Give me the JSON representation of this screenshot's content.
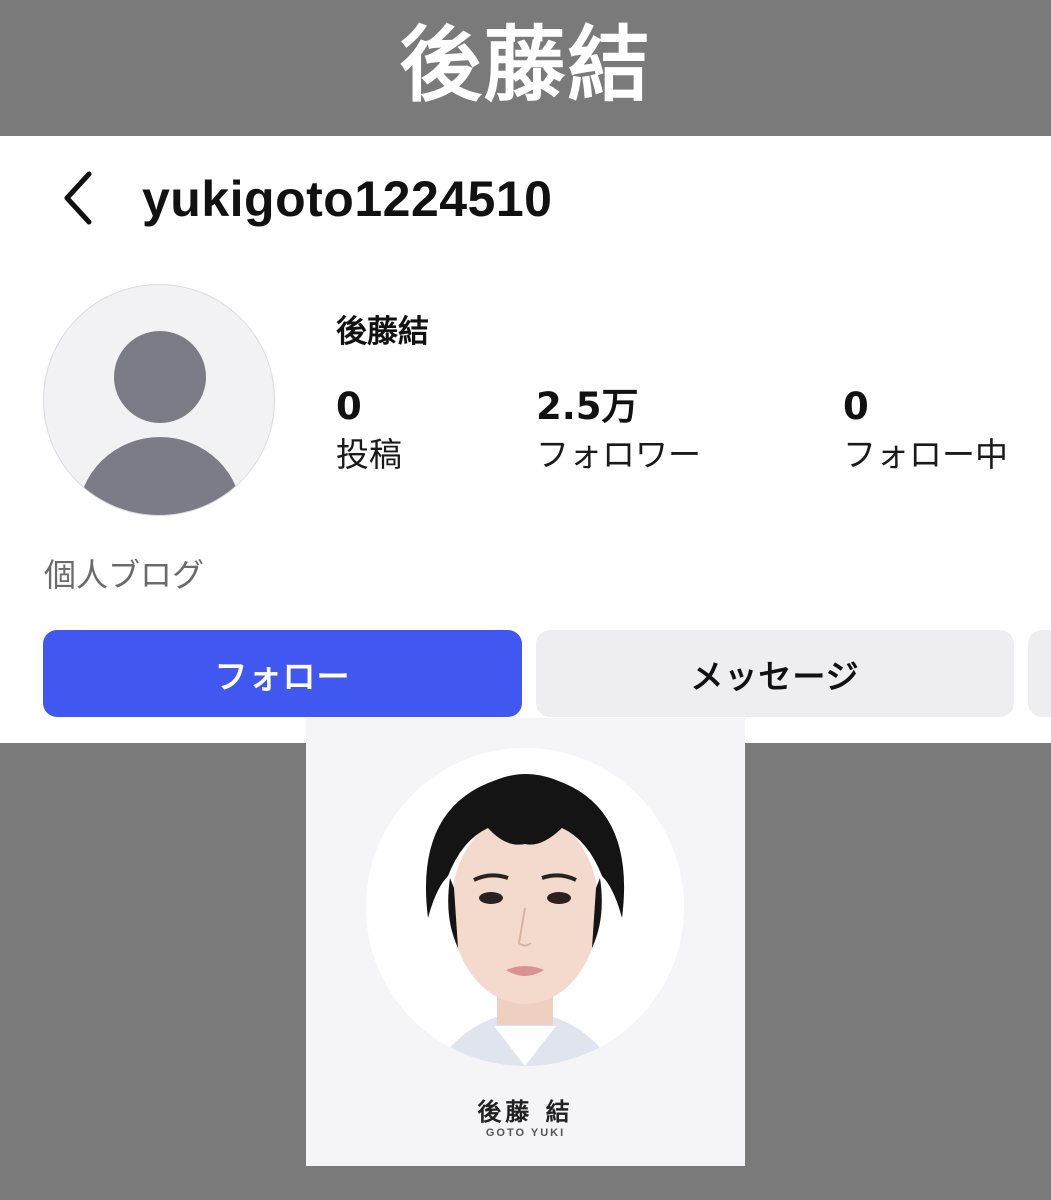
{
  "banner": {
    "title": "後藤結"
  },
  "header": {
    "username": "yukigoto1224510"
  },
  "profile": {
    "display_name": "後藤結",
    "stats": [
      {
        "value": "0",
        "label": "投稿"
      },
      {
        "value": "2.5万",
        "label": "フォロワー"
      },
      {
        "value": "0",
        "label": "フォロー中"
      }
    ],
    "bio": "個人ブログ",
    "avatar_icon": "default-person-icon"
  },
  "actions": {
    "follow_label": "フォロー",
    "message_label": "メッセージ"
  },
  "photo_card": {
    "name": "後藤 結",
    "romanized": "GOTO YUKI"
  },
  "colors": {
    "background": "#7a7a7a",
    "follow_button": "#4158f0",
    "secondary_button": "#eeeef1",
    "avatar_silhouette": "#7b7c85"
  }
}
